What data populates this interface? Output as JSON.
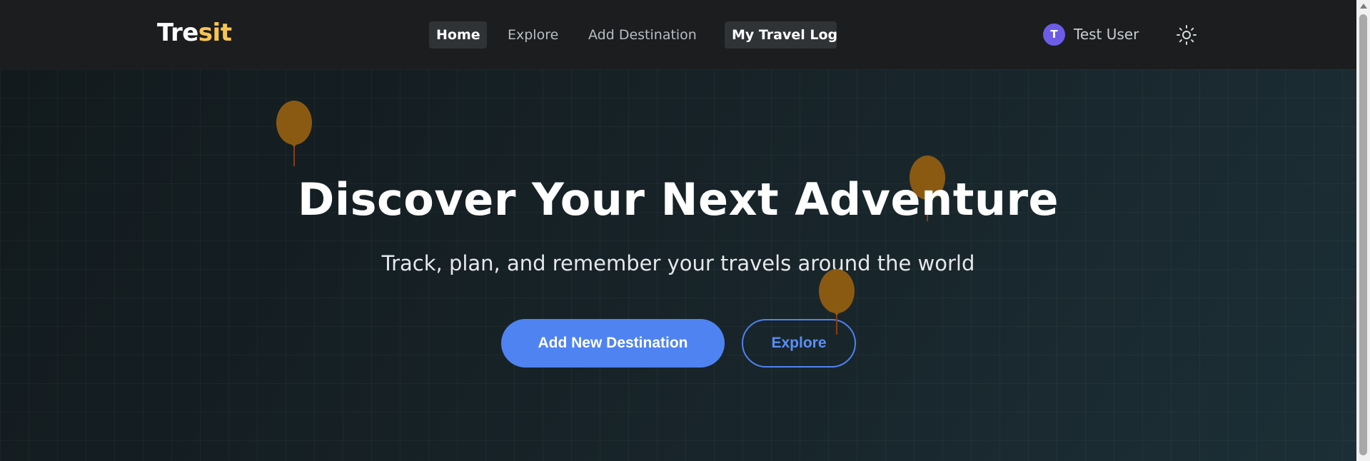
{
  "logo": {
    "part1": "Tre",
    "part2": "sit"
  },
  "nav": {
    "home": "Home",
    "explore": "Explore",
    "add_destination": "Add Destination",
    "travel_log": "My Travel Log"
  },
  "user": {
    "initial": "T",
    "name": "Test User"
  },
  "theme_toggle": {
    "icon": "sun-icon"
  },
  "hero": {
    "title": "Discover Your Next Adventure",
    "subtitle": "Track, plan, and remember your travels around the world",
    "primary_button": "Add New Destination",
    "secondary_button": "Explore"
  },
  "colors": {
    "brand_accent": "#f6c453",
    "primary": "#4f83f1",
    "avatar": "#6c5ce7",
    "balloon": "#8b5a12"
  }
}
